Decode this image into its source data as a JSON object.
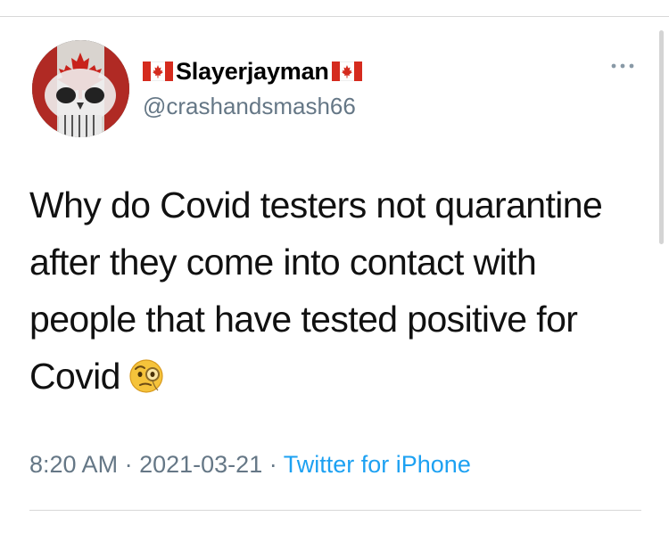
{
  "tweet": {
    "author": {
      "display_name": "Slayerjayman",
      "handle": "@crashandsmash66",
      "avatar": "punisher-skull-canada-flag"
    },
    "text_lines": [
      "Why do Covid testers not quarantine",
      "after they come into contact with",
      "people that have tested positive for",
      "Covid"
    ],
    "emoji": "face-with-monocle",
    "time": "8:20 AM",
    "date": "2021-03-21",
    "separator": "·",
    "source": "Twitter for iPhone"
  },
  "icons": {
    "more": "more-horizontal-icon",
    "flag": "canada-flag-icon"
  },
  "colors": {
    "secondary_text": "#657786",
    "link": "#1da1f2",
    "divider": "#d8d8d8",
    "flag_red": "#d52b1e"
  }
}
